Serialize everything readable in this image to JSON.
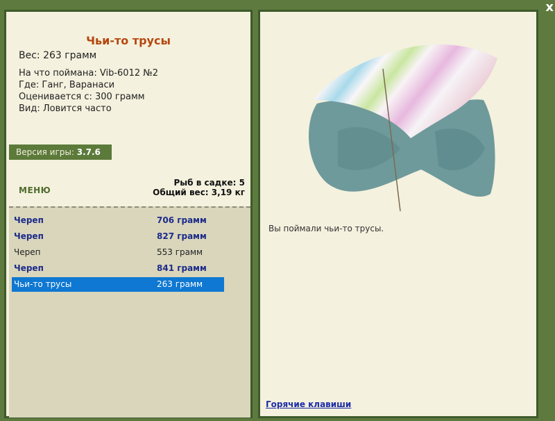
{
  "item": {
    "title": "Чьи-то трусы",
    "weight": "Вес: 263 грамм",
    "bait": "На что поймана: Vib-6012 №2",
    "location": "Где: Ганг, Варанаси",
    "value": "Оценивается с: 300 грамм",
    "kind": "Вид: Ловится часто"
  },
  "version": {
    "label": "Версия игры:",
    "number": "3.7.6"
  },
  "menu_label": "МЕНЮ",
  "stats": {
    "fish_count": "Рыб в садке: 5",
    "total_weight": "Общий вес: 3,19 кг"
  },
  "catch_list": [
    {
      "name": "Череп",
      "weight": "706 грамм",
      "style": "bold"
    },
    {
      "name": "Череп",
      "weight": "827 грамм",
      "style": "bold"
    },
    {
      "name": "Череп",
      "weight": "553 грамм",
      "style": "normal"
    },
    {
      "name": "Череп",
      "weight": "841 грамм",
      "style": "bold"
    },
    {
      "name": "Чьи-то трусы",
      "weight": "263 грамм",
      "style": "selected"
    }
  ],
  "caught_message": "Вы поймали чьи-то трусы.",
  "hotkeys_label": "Горячие клавиши",
  "close_label": "x",
  "colors": {
    "background": "#5f7a3e",
    "panel": "#f4f1de",
    "title": "#b5470f",
    "bold_row": "#1c2a8a",
    "selected": "#0e78d2"
  }
}
